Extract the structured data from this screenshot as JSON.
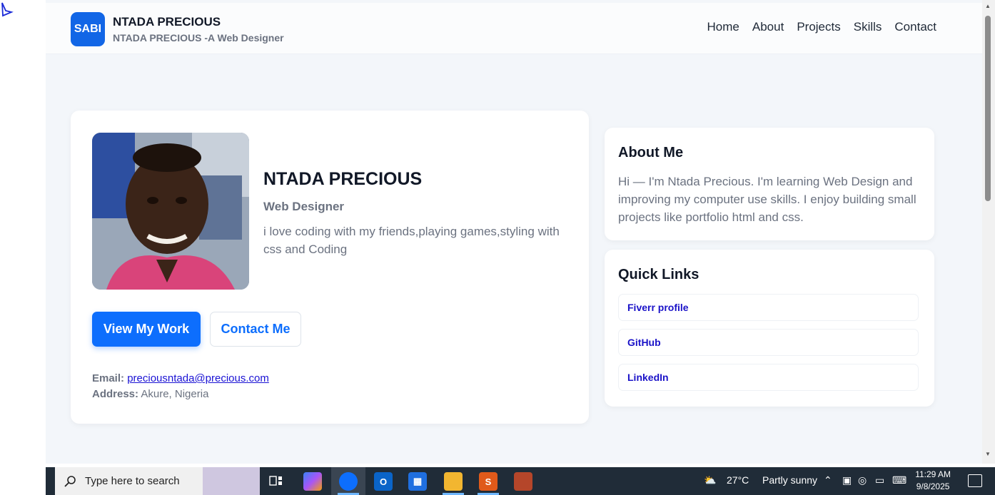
{
  "header": {
    "logo_text": "SABI",
    "brand_title": "NTADA PRECIOUS",
    "brand_subtitle": "NTADA PRECIOUS -A Web Designer",
    "nav": [
      "Home",
      "About",
      "Projects",
      "Skills",
      "Contact"
    ]
  },
  "hero": {
    "name": "NTADA PRECIOUS",
    "role": "Web Designer",
    "bio": "i love coding with my friends,playing games,styling with css and Coding",
    "primary_button": "View My Work",
    "secondary_button": "Contact Me",
    "email_label": "Email:",
    "email_value": "preciousntada@precious.com",
    "address_label": "Address:",
    "address_value": "Akure, Nigeria"
  },
  "about": {
    "title": "About Me",
    "text": "Hi — I'm Ntada Precious. I'm learning Web Design and improving my computer use skills. I enjoy building small projects like portfolio html and css."
  },
  "quick_links": {
    "title": "Quick Links",
    "items": [
      "Fiverr profile",
      "GitHub",
      "LinkedIn"
    ]
  },
  "taskbar": {
    "search_placeholder": "Type here to search",
    "weather_temp": "27°C",
    "weather_text": "Partly sunny",
    "time": "11:29 AM",
    "date": "9/8/2025"
  },
  "colors": {
    "accent": "#0d6efd",
    "logo_bg": "#1266e6",
    "link": "#1a12c8",
    "page_bg": "#f3f6fa",
    "taskbar_bg": "#202c38"
  }
}
